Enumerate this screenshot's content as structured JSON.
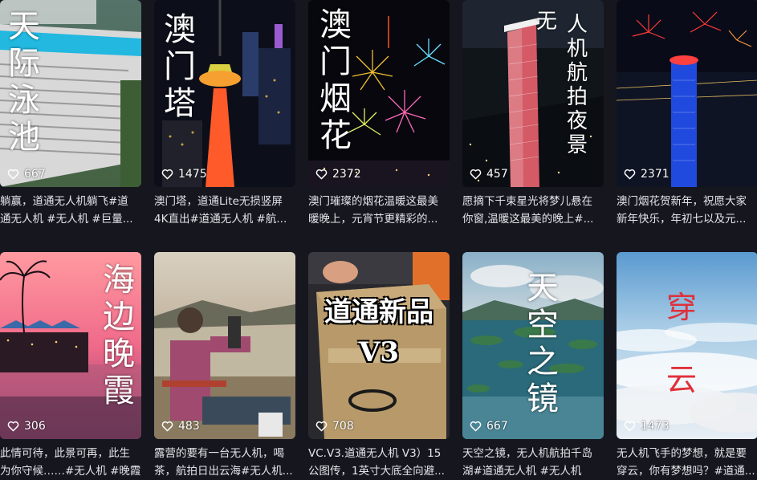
{
  "videos": [
    {
      "title": [
        "天",
        "际",
        "泳",
        "池"
      ],
      "likes": "667",
      "desc": [
        "躺赢，道通无人机躺飞#道",
        "通无人机 #无人机 #巨量..."
      ]
    },
    {
      "title": [
        "澳",
        "门",
        "塔"
      ],
      "likes": "1475",
      "desc": [
        "澳门塔，道通Lite无损竖屏",
        "4K直出#道通无人机 #航..."
      ]
    },
    {
      "title": [
        "澳",
        "门",
        "烟",
        "花"
      ],
      "likes": "2372",
      "desc": [
        "澳门璀璨的烟花温暖这最美",
        "暖晚上，元宵节更精彩的..."
      ]
    },
    {
      "title": [
        "无",
        "人",
        "机",
        "航",
        "拍",
        "夜",
        "景"
      ],
      "likes": "457",
      "desc": [
        "愿摘下千束星光将梦儿悬在",
        "你窗,温暖这最美的晚上#..."
      ]
    },
    {
      "title": [],
      "likes": "2371",
      "desc": [
        "澳门烟花贺新年，祝愿大家",
        "新年快乐，年初七以及元..."
      ]
    },
    {
      "title": [
        "海",
        "边",
        "晚",
        "霞"
      ],
      "likes": "306",
      "desc": [
        "此情可待，此景可再，此生",
        "为你守候……#无人机 #晚霞"
      ]
    },
    {
      "title": [],
      "likes": "483",
      "desc": [
        "露营的要有一台无人机，喝",
        "茶，航拍日出云海#无人机..."
      ]
    },
    {
      "title": [
        "道通新品",
        "V3"
      ],
      "likes": "708",
      "desc": [
        "VC.V3.道通无人机 V3）15",
        "公图传，1英寸大底全向避..."
      ]
    },
    {
      "title": [
        "天",
        "空",
        "之",
        "镜"
      ],
      "likes": "667",
      "desc": [
        "天空之镜，无人机航拍千岛",
        "湖#道通无人机 #无人机"
      ]
    },
    {
      "title": [
        "穿",
        "云"
      ],
      "likes": "1473",
      "desc": [
        "无人机飞手的梦想，就是要",
        "穿云，你有梦想吗？#道通..."
      ]
    }
  ]
}
